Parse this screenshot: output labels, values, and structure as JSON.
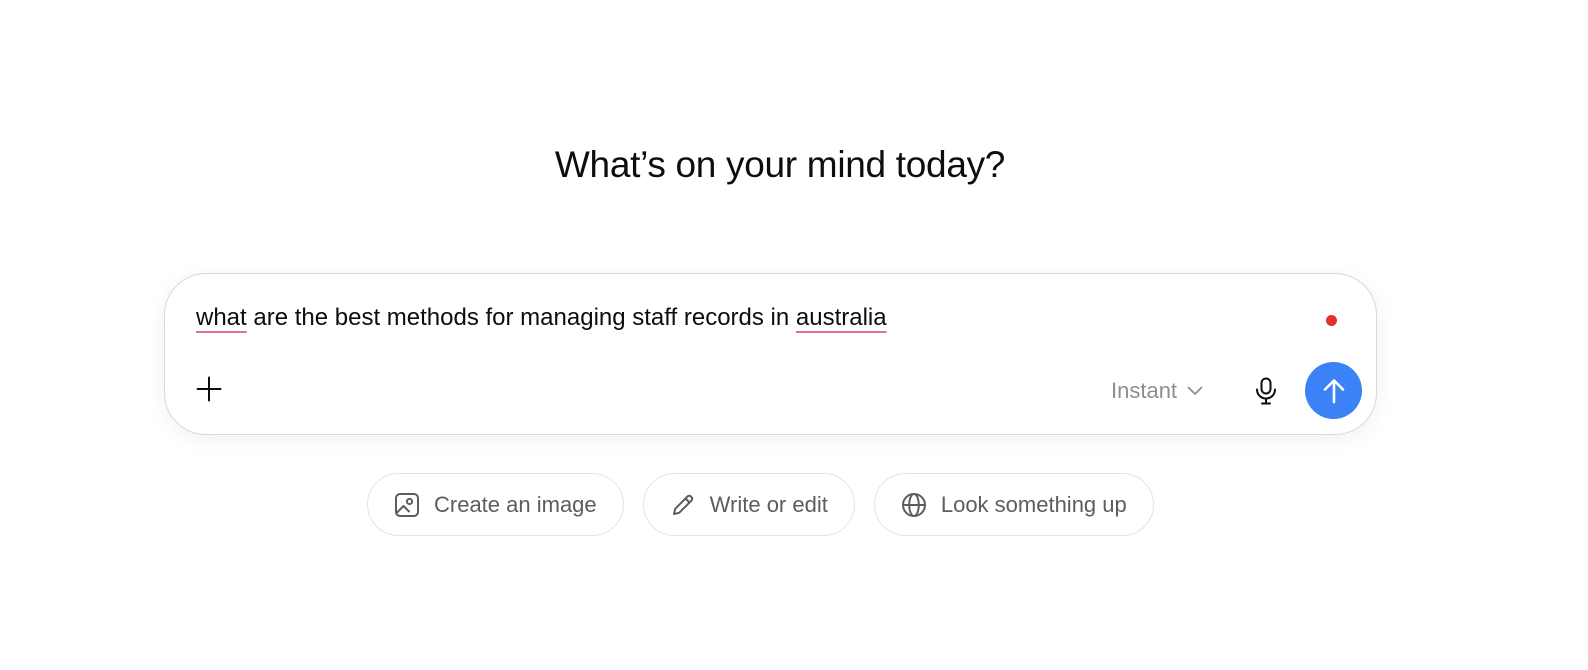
{
  "heading": "What’s on your mind today?",
  "composer": {
    "prompt_parts": [
      "what",
      " are the best methods for managing staff records in ",
      "australia"
    ],
    "model_label": "Instant",
    "recording_dot_color": "#e0322b",
    "send_color": "#3b82f6"
  },
  "icons": {
    "add": "plus-icon",
    "model": "chevron-down-icon",
    "mic": "microphone-icon",
    "send": "arrow-up-icon"
  },
  "suggestions": [
    {
      "label": "Create an image",
      "icon": "image-icon"
    },
    {
      "label": "Write or edit",
      "icon": "pencil-icon"
    },
    {
      "label": "Look something up",
      "icon": "globe-icon"
    }
  ]
}
